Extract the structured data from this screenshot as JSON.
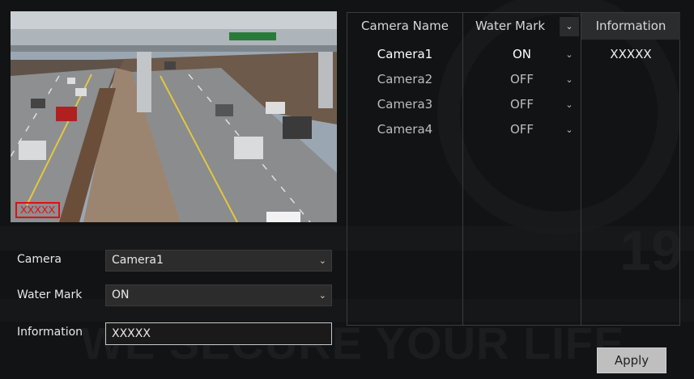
{
  "preview": {
    "watermark_text": "XXXXX",
    "watermark_color": "#e01010"
  },
  "form": {
    "camera_label": "Camera",
    "camera_value": "Camera1",
    "watermark_label": "Water Mark",
    "watermark_value": "ON",
    "information_label": "Information",
    "information_value": "XXXXX"
  },
  "table": {
    "headers": {
      "camera_name": "Camera Name",
      "water_mark": "Water Mark",
      "information": "Information"
    },
    "rows": [
      {
        "name": "Camera1",
        "water_mark": "ON",
        "information": "XXXXX",
        "selected": true
      },
      {
        "name": "Camera2",
        "water_mark": "OFF",
        "information": ""
      },
      {
        "name": "Camera3",
        "water_mark": "OFF",
        "information": ""
      },
      {
        "name": "Camera4",
        "water_mark": "OFF",
        "information": ""
      }
    ]
  },
  "apply_label": "Apply",
  "background": {
    "slogan": "WE SECURE YOUR LIFE",
    "year_fragment": "19"
  },
  "icons": {
    "dropdown": "chevron-down-icon"
  }
}
